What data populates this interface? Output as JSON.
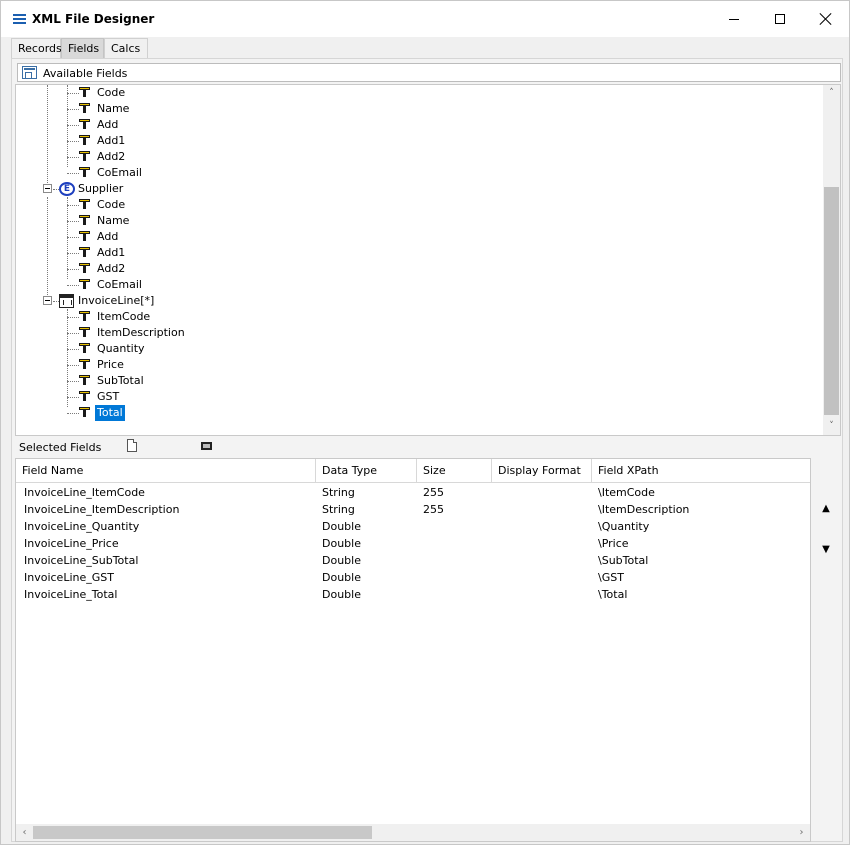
{
  "window": {
    "title": "XML File Designer",
    "minimize_label": "",
    "maximize_label": "",
    "close_label": ""
  },
  "tabs": [
    {
      "label": "Records",
      "active": false
    },
    {
      "label": "Fields",
      "active": true
    },
    {
      "label": "Calcs",
      "active": false
    }
  ],
  "available_fields": {
    "header": "Available Fields",
    "tree": {
      "group0_children": [
        "Code",
        "Name",
        "Add",
        "Add1",
        "Add2",
        "CoEmail"
      ],
      "supplier": {
        "label": "Supplier",
        "icon_letter": "E",
        "children": [
          "Code",
          "Name",
          "Add",
          "Add1",
          "Add2",
          "CoEmail"
        ]
      },
      "invoiceline": {
        "label": "InvoiceLine[*]",
        "children": [
          "ItemCode",
          "ItemDescription",
          "Quantity",
          "Price",
          "SubTotal",
          "GST",
          "Total"
        ]
      },
      "selected_item": "Total"
    },
    "scroll_up": "˄",
    "scroll_down": "˅"
  },
  "selected_fields": {
    "label": "Selected Fields",
    "columns": [
      "Field Name",
      "Data Type",
      "Size",
      "Display Format",
      "Field XPath"
    ],
    "rows": [
      {
        "name": "InvoiceLine_ItemCode",
        "type": "String",
        "size": "255",
        "format": "",
        "xpath": "\\ItemCode"
      },
      {
        "name": "InvoiceLine_ItemDescription",
        "type": "String",
        "size": "255",
        "format": "",
        "xpath": "\\ItemDescription"
      },
      {
        "name": "InvoiceLine_Quantity",
        "type": "Double",
        "size": "",
        "format": "",
        "xpath": "\\Quantity"
      },
      {
        "name": "InvoiceLine_Price",
        "type": "Double",
        "size": "",
        "format": "",
        "xpath": "\\Price"
      },
      {
        "name": "InvoiceLine_SubTotal",
        "type": "Double",
        "size": "",
        "format": "",
        "xpath": "\\SubTotal"
      },
      {
        "name": "InvoiceLine_GST",
        "type": "Double",
        "size": "",
        "format": "",
        "xpath": "\\GST"
      },
      {
        "name": "InvoiceLine_Total",
        "type": "Double",
        "size": "",
        "format": "",
        "xpath": "\\Total"
      }
    ],
    "move_up": "▲",
    "move_down": "▼",
    "scroll_left": "‹",
    "scroll_right": "›"
  },
  "icons": {
    "app": "menu-icon",
    "available_fields": "fields-list-icon",
    "field": "field-t-icon",
    "object": "object-e-icon",
    "array": "table-icon",
    "new_doc": "document-icon",
    "film": "film-icon"
  },
  "colors": {
    "selection": "#0078d7",
    "object_icon": "#1d3fbf",
    "app_icon": "#1b5fb0"
  }
}
